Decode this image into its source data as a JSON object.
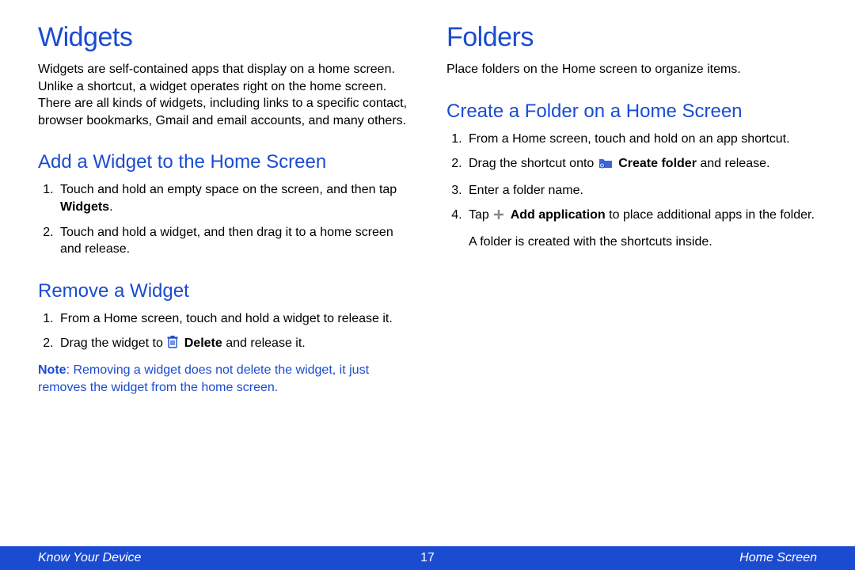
{
  "left": {
    "h1": "Widgets",
    "intro": "Widgets are self-contained apps that display on a home screen. Unlike a shortcut, a widget operates right on the home screen. There are all kinds of widgets, including links to a specific contact, browser bookmarks, Gmail and email accounts, and many others.",
    "s1": {
      "h2": "Add a Widget to the Home Screen",
      "i1a": "Touch and hold an empty space on the screen, and then tap ",
      "i1b": "Widgets",
      "i1c": ".",
      "i2": "Touch and hold a widget, and then drag it to a home screen and release."
    },
    "s2": {
      "h2": "Remove a Widget",
      "i1": "From a Home screen, touch and hold a widget to release it.",
      "i2a": "Drag the widget to ",
      "i2b": "Delete",
      "i2c": " and release it.",
      "noteLabel": "Note",
      "noteText": ": Removing a widget does not delete the widget, it just removes the widget from the home screen."
    }
  },
  "right": {
    "h1": "Folders",
    "intro": "Place folders on the Home screen to organize items.",
    "s1": {
      "h2": "Create a Folder on a Home Screen",
      "i1": "From a Home screen, touch and hold on an app shortcut.",
      "i2a": "Drag the shortcut onto ",
      "i2b": "Create folder",
      "i2c": " and release.",
      "i3": "Enter a folder name.",
      "i4a": "Tap ",
      "i4b": "Add application",
      "i4c": " to place additional apps in the folder.",
      "tail": "A folder is created with the shortcuts inside."
    }
  },
  "footer": {
    "left": "Know Your Device",
    "center": "17",
    "right": "Home Screen"
  },
  "icons": {
    "delete": "delete-icon",
    "createFolder": "create-folder-icon",
    "add": "plus-icon"
  }
}
